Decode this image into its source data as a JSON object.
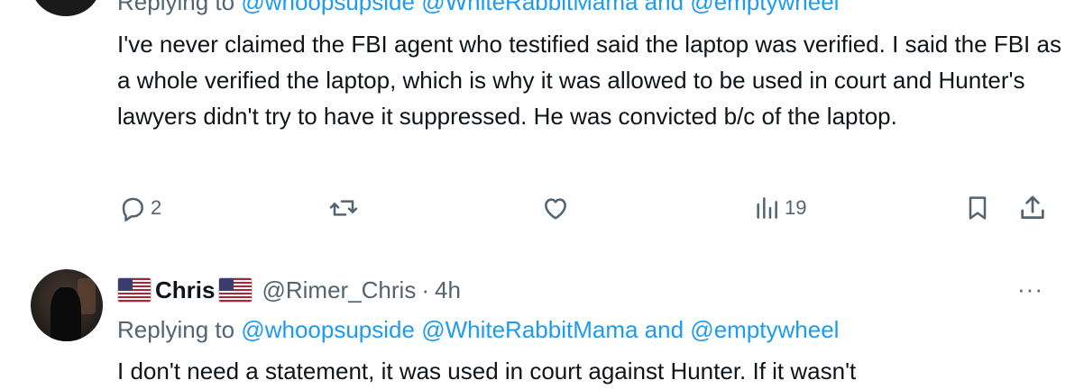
{
  "tweet_top": {
    "replying_prefix": "Replying to",
    "replying_mentions": [
      "@whoopsupside",
      "@WhiteRabbitMama"
    ],
    "replying_and": "and",
    "replying_last": "@emptywheel",
    "text": "I've never claimed the FBI agent who testified said the laptop was verified. I said the FBI as a whole verified the laptop, which is why it was allowed to be used in court and Hunter's lawyers didn't try to have it suppressed. He was convicted b/c of the laptop.",
    "actions": {
      "reply_count": "2",
      "retweet_count": "",
      "like_count": "",
      "views_count": "19"
    },
    "icons": [
      "reply-icon",
      "retweet-icon",
      "like-icon",
      "views-icon",
      "bookmark-icon",
      "share-icon"
    ]
  },
  "tweet_chris": {
    "display_name": "Chris",
    "handle": "@Rimer_Chris",
    "separator": "·",
    "time": "4h",
    "more": "···",
    "replying_prefix": "Replying to",
    "replying_mentions": [
      "@whoopsupside",
      "@WhiteRabbitMama"
    ],
    "replying_and": "and",
    "replying_last": "@emptywheel",
    "text": "I don't need a statement,  it was used in court against Hunter. If it wasn't"
  },
  "colors": {
    "text": "#0f1419",
    "secondary": "#536471",
    "link": "#1d9bf0"
  }
}
